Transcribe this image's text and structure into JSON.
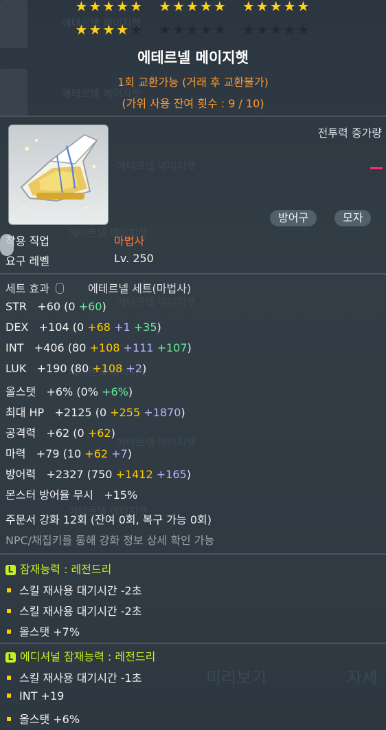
{
  "stars": {
    "row1": "★★★★★",
    "row2": "★★★★★",
    "row3": "★★★★★",
    "row4_on": "★★★★",
    "row4_off": "★",
    "row5": "★★★★★",
    "row6": "★★★★★"
  },
  "item": {
    "name": "에테르넬 메이지햇",
    "trade_line1": "1회 교환가능 (거래 후 교환불가)",
    "trade_line2": "(가위 사용 잔여 횟수 : 9 / 10)",
    "cp_label": "전투력 증가량",
    "tags": [
      "방어구",
      "모자"
    ],
    "job_label": "착용 직업",
    "job_value": "마법사",
    "level_label": "요구 레벨",
    "level_value": "Lv. 250"
  },
  "set": {
    "label": "세트 효과",
    "value": "에테르넬 세트(마법사)"
  },
  "stats": {
    "str": {
      "label": "STR",
      "total": "+60",
      "base": "(0",
      "p1": "+60",
      "close": ")"
    },
    "dex": {
      "label": "DEX",
      "total": "+104",
      "base": "(0",
      "p1": "+68",
      "p2": "+1",
      "p3": "+35",
      "close": ")"
    },
    "int": {
      "label": "INT",
      "total": "+406",
      "base": "(80",
      "p1": "+108",
      "p2": "+111",
      "p3": "+107",
      "close": ")"
    },
    "luk": {
      "label": "LUK",
      "total": "+190",
      "base": "(80",
      "p1": "+108",
      "p2": "+2",
      "close": ")"
    },
    "all": {
      "label": "올스탯",
      "total": "+6%",
      "base": "(0%",
      "p1": "+6%",
      "close": ")"
    },
    "hp": {
      "label": "최대 HP",
      "total": "+2125",
      "base": "(0",
      "p1": "+255",
      "p2": "+1870",
      "close": ")"
    },
    "atk": {
      "label": "공격력",
      "total": "+62",
      "base": "(0",
      "p1": "+62",
      "close": ")"
    },
    "mag": {
      "label": "마력",
      "total": "+79",
      "base": "(10",
      "p1": "+62",
      "p2": "+7",
      "close": ")"
    },
    "def": {
      "label": "방어력",
      "total": "+2327",
      "base": "(750",
      "p1": "+1412",
      "p2": "+165",
      "close": ")"
    },
    "ign": {
      "label": "몬스터 방어율 무시",
      "total": "+15%"
    }
  },
  "scroll": {
    "line": "주문서 강화 12회 (잔여 0회, 복구 가능 0회)",
    "note": "NPC/채집키를 통해 강화 정보 상세 확인 가능"
  },
  "potential": {
    "badge": "L",
    "title": "잠재능력 : 레전드리",
    "lines": [
      "스킬 재사용 대기시간 -2초",
      "스킬 재사용 대기시간 -2초",
      "올스탯 +7%"
    ]
  },
  "additional": {
    "badge": "L",
    "title": "에디셔널 잠재능력 : 레전드리",
    "lines": [
      "스킬 재사용 대기시간 -1초",
      "INT +19",
      "올스탯 +6%"
    ]
  },
  "background": {
    "ghost_name": "에테르넬 메이지햇",
    "ghost_preview": "미리보기",
    "ghost_detail": "자세"
  },
  "colors": {
    "star_on": "#ffd21a",
    "trade": "#ff9a2e",
    "job": "#ff7a3a",
    "yellow": "#ffcc00",
    "green": "#66ee99",
    "purple": "#b9b9ff",
    "legendary": "#c6f021"
  }
}
